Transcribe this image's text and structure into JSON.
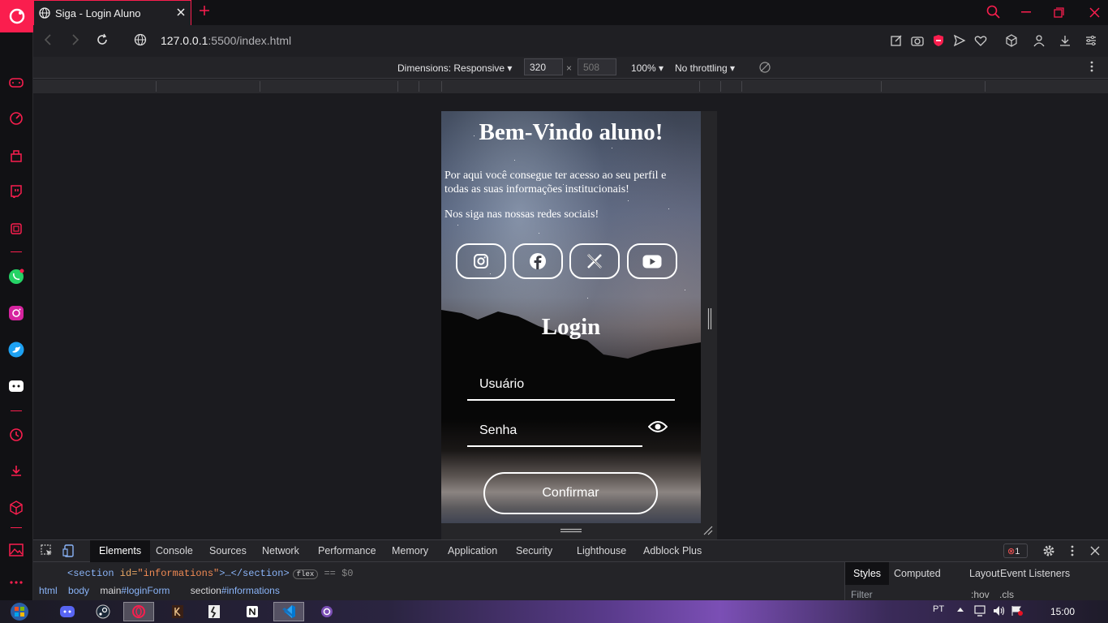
{
  "browser": {
    "tab_title": "Siga - Login Aluno",
    "url_host": "127.0.0.1",
    "url_rest": ":5500/index.html",
    "accent": "#fa1e4e"
  },
  "device_toolbar": {
    "dimensions_label": "Dimensions: Responsive",
    "width": "320",
    "height_placeholder": "508",
    "separator": "×",
    "zoom": "100%",
    "throttling": "No throttling"
  },
  "page": {
    "heading": "Bem-Vindo aluno!",
    "intro": "Por aqui você consegue ter acesso ao seu perfil e todas as suas informações institucionais!",
    "social_prompt": "Nos siga nas nossas redes sociais!",
    "social_icons": [
      "instagram-icon",
      "facebook-icon",
      "x-icon",
      "youtube-icon"
    ],
    "login_heading": "Login",
    "username_placeholder": "Usuário",
    "password_placeholder": "Senha",
    "confirm_label": "Confirmar"
  },
  "devtools": {
    "tabs": [
      "Elements",
      "Console",
      "Sources",
      "Network",
      "Performance",
      "Memory",
      "Application",
      "Security",
      "Lighthouse",
      "Adblock Plus"
    ],
    "error_count": "1",
    "dom_tag_open": "<section",
    "dom_attr": " id=",
    "dom_attr_value": "\"informations\"",
    "dom_tag_rest": ">…</section>",
    "dom_badge": "flex",
    "dom_eq": "== $0",
    "breadcrumbs": [
      "html",
      "body",
      "main",
      "#loginForm",
      "section",
      "#informations"
    ],
    "styles_tabs": [
      "Styles",
      "Computed",
      "Layout",
      "Event Listeners"
    ],
    "filter_placeholder": "Filter",
    "hov": ":hov",
    "cls": ".cls"
  },
  "taskbar": {
    "language": "PT",
    "time": "15:00"
  }
}
